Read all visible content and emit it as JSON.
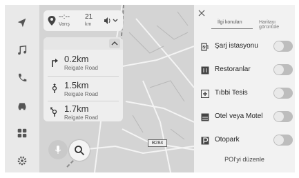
{
  "rail": {
    "items": [
      {
        "name": "navigation-arrow-icon"
      },
      {
        "name": "music-note-icon"
      },
      {
        "name": "phone-icon"
      },
      {
        "name": "car-icon"
      },
      {
        "name": "apps-grid-icon"
      },
      {
        "name": "settings-gear-icon"
      }
    ]
  },
  "eta": {
    "time": "--:--",
    "time_label": "Varış",
    "distance": "21",
    "distance_label": "km"
  },
  "guidance": {
    "maneuvers": [
      {
        "distance": "0.2km",
        "road": "Reigate Road",
        "icon": "turn-right-arrow-icon"
      },
      {
        "distance": "1.5km",
        "road": "Reigate Road",
        "icon": "roundabout-icon"
      },
      {
        "distance": "1.7km",
        "road": "Reigate Road",
        "icon": "roundabout-exit-icon"
      }
    ]
  },
  "map": {
    "road_sign": "B284"
  },
  "panel": {
    "tabs": [
      "İlgi konuları",
      "Haritayı görüntüle"
    ],
    "poi": [
      {
        "label": "Şarj istasyonu",
        "icon": "charging-station-icon",
        "enabled": false
      },
      {
        "label": "Restoranlar",
        "icon": "restaurant-icon",
        "enabled": false
      },
      {
        "label": "Tıbbi Tesis",
        "icon": "medical-icon",
        "enabled": false
      },
      {
        "label": "Otel veya Motel",
        "icon": "hotel-icon",
        "enabled": false
      },
      {
        "label": "Otopark",
        "icon": "parking-icon",
        "enabled": false
      }
    ],
    "edit_label": "POI'yi düzenle"
  }
}
